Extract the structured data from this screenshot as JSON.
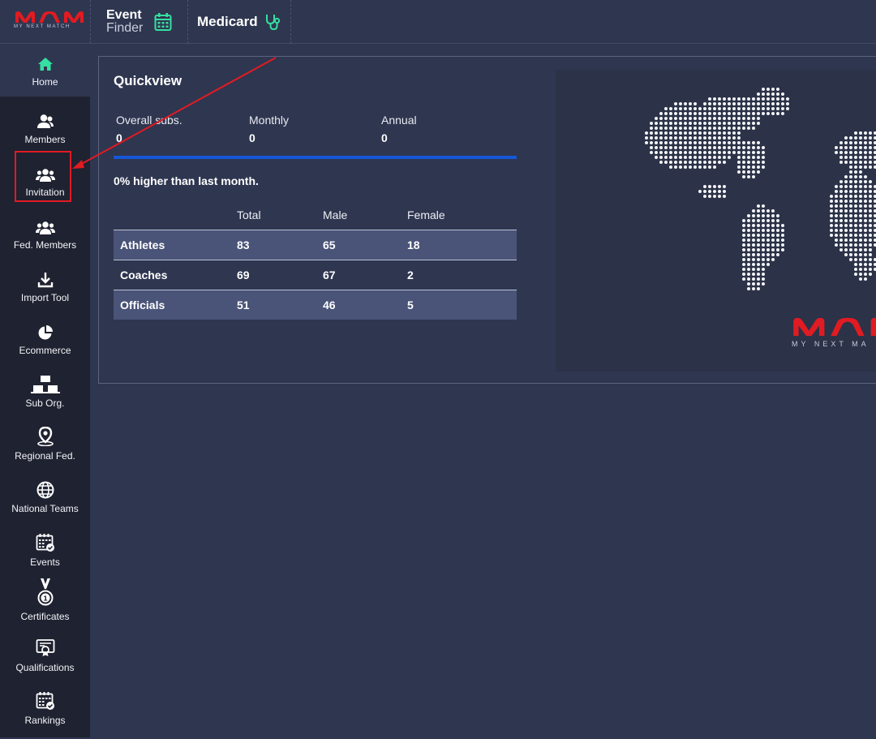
{
  "header": {
    "logo_tagline": "MY NEXT MATCH",
    "event_finder": {
      "line1": "Event",
      "line2": "Finder",
      "icon": "calendar-icon"
    },
    "medicard": {
      "label": "Medicard",
      "icon": "stethoscope-icon"
    }
  },
  "sidebar": {
    "items": [
      {
        "label": "Home",
        "icon": "home-icon",
        "active": true
      },
      {
        "label": "Members",
        "icon": "users-icon"
      },
      {
        "label": "Invitation",
        "icon": "users-group-icon",
        "highlighted": true
      },
      {
        "label": "Fed. Members",
        "icon": "users-group-icon"
      },
      {
        "label": "Import Tool",
        "icon": "download-icon"
      },
      {
        "label": "Ecommerce",
        "icon": "pie-chart-icon"
      },
      {
        "label": "Sub Org.",
        "icon": "sub-org-icon"
      },
      {
        "label": "Regional Fed.",
        "icon": "map-pin-icon"
      },
      {
        "label": "National Teams",
        "icon": "globe-icon"
      },
      {
        "label": "Events",
        "icon": "calendar-check-icon"
      },
      {
        "label": "Certificates",
        "icon": "medal-icon"
      },
      {
        "label": "Qualifications",
        "icon": "certificate-icon"
      },
      {
        "label": "Rankings",
        "icon": "calendar-check-icon"
      }
    ]
  },
  "quickview": {
    "title": "Quickview",
    "stats": [
      {
        "label": "Overall subs.",
        "value": "0"
      },
      {
        "label": "Monthly",
        "value": "0"
      },
      {
        "label": "Annual",
        "value": "0"
      }
    ],
    "growth_text": "0% higher than last month.",
    "table": {
      "headers": [
        "",
        "Total",
        "Male",
        "Female"
      ],
      "rows": [
        [
          "Athletes",
          "83",
          "65",
          "18"
        ],
        [
          "Coaches",
          "69",
          "67",
          "2"
        ],
        [
          "Officials",
          "51",
          "46",
          "5"
        ]
      ]
    },
    "map_logo_tagline": "MY NEXT MA"
  },
  "colors": {
    "accent_red": "#e11b22",
    "progress_blue": "#1557d6",
    "icon_green": "#35e0a0",
    "background": "#2f3650",
    "sidebar": "#1f2230"
  }
}
